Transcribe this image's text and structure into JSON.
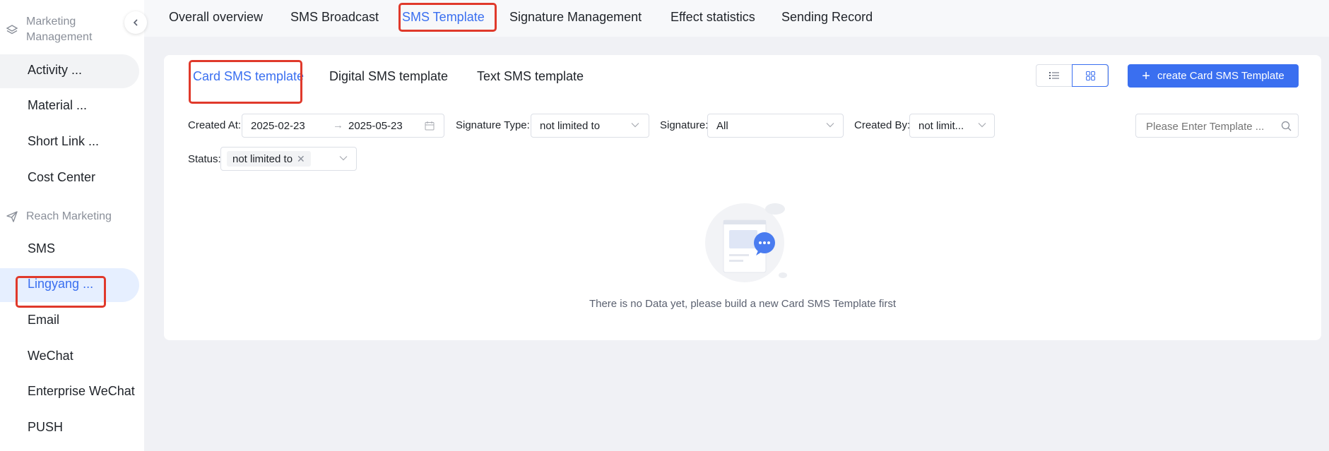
{
  "sidebar": {
    "groups": [
      {
        "label": "Marketing Management",
        "icon": "layers-icon"
      },
      {
        "label": "Reach Marketing",
        "icon": "send-icon"
      }
    ],
    "items": [
      {
        "label": "Activity ..."
      },
      {
        "label": "Material ..."
      },
      {
        "label": "Short Link ..."
      },
      {
        "label": "Cost Center"
      },
      {
        "label": "SMS"
      },
      {
        "label": "Lingyang ..."
      },
      {
        "label": "Email"
      },
      {
        "label": "WeChat"
      },
      {
        "label": "Enterprise WeChat"
      },
      {
        "label": "PUSH"
      }
    ],
    "active_item": "Lingyang ..."
  },
  "top_tabs": [
    {
      "label": "Overall overview"
    },
    {
      "label": "SMS Broadcast"
    },
    {
      "label": "SMS Template"
    },
    {
      "label": "Signature Management"
    },
    {
      "label": "Effect statistics"
    },
    {
      "label": "Sending Record"
    }
  ],
  "active_top_tab": "SMS Template",
  "sub_tabs": [
    {
      "label": "Card SMS template"
    },
    {
      "label": "Digital SMS template"
    },
    {
      "label": "Text SMS template"
    }
  ],
  "active_sub_tab": "Card SMS template",
  "create_button": {
    "label": "create Card SMS Template",
    "icon": "plus-icon"
  },
  "view_toggle": {
    "options": [
      "list-view-icon",
      "grid-view-icon"
    ],
    "selected": "grid-view-icon"
  },
  "filters": {
    "created_at": {
      "label": "Created At:",
      "start": "2025-02-23",
      "end": "2025-05-23"
    },
    "signature_type": {
      "label": "Signature Type:",
      "value": "not limited to"
    },
    "signature": {
      "label": "Signature:",
      "value": "All"
    },
    "created_by": {
      "label": "Created By:",
      "value": "not limit..."
    },
    "search": {
      "placeholder": "Please Enter Template ..."
    },
    "status": {
      "label": "Status:",
      "tag": "not limited to"
    }
  },
  "empty_state": {
    "message": "There is no Data yet, please build a new Card SMS Template first"
  },
  "colors": {
    "accent": "#3a6ff0",
    "highlight_box": "#e0392b",
    "page_bg": "#f0f1f5"
  }
}
